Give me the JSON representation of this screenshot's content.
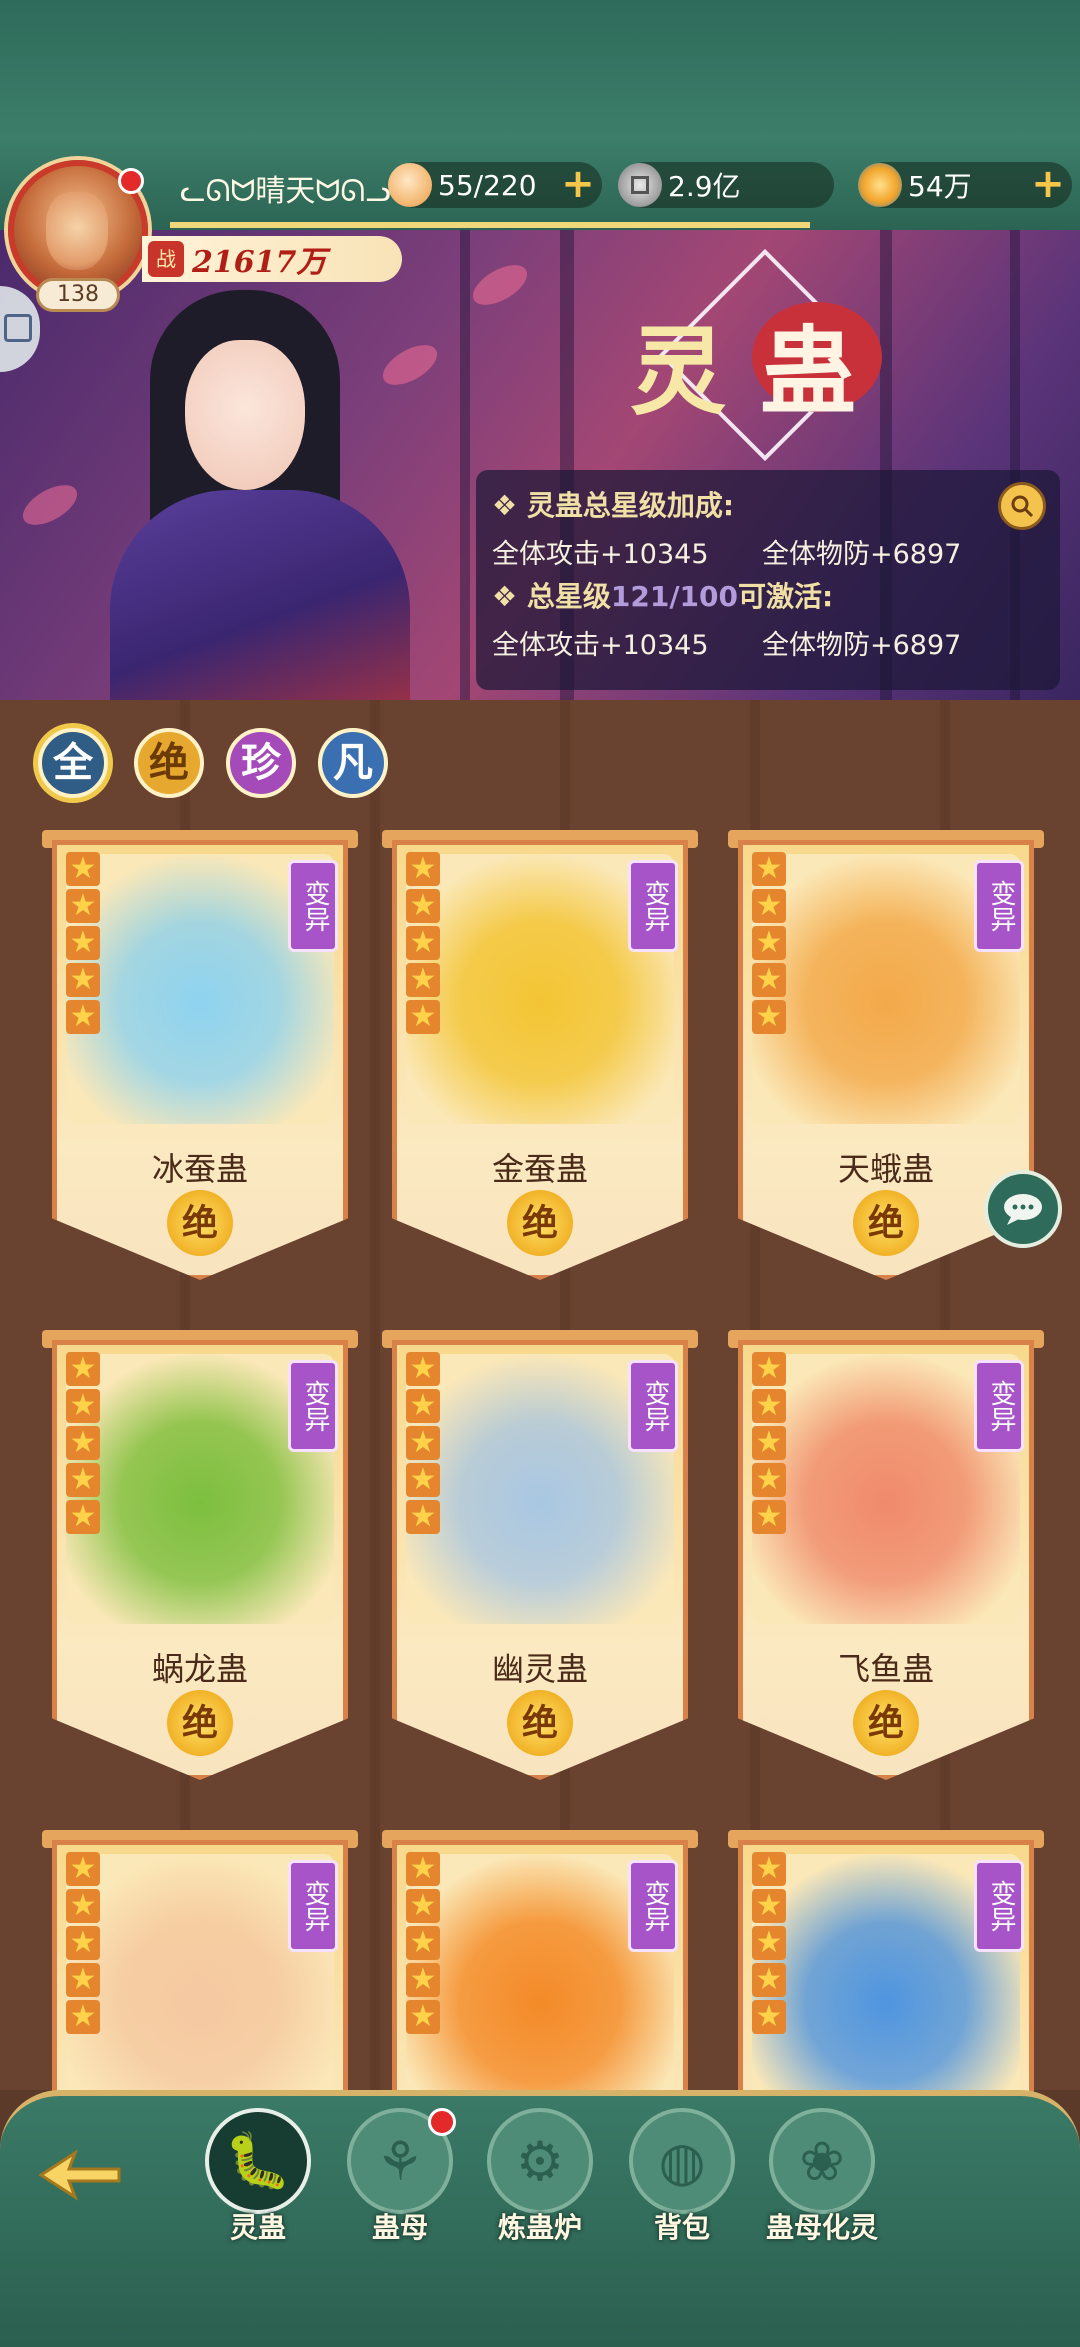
{
  "player": {
    "name": "ᓚᘏᗢ晴天ᗢᘏᓗ",
    "level": "138",
    "power_tag": "战",
    "power": "21617万"
  },
  "resources": {
    "buns": "55/220",
    "coins": "2.9亿",
    "gems": "54万"
  },
  "banner": {
    "title_1": "灵",
    "title_2": "蛊",
    "total_bonus_label": "灵蛊总星级加成:",
    "total_attack": "全体攻击+10345",
    "total_defense": "全体物防+6897",
    "activate_prefix": "总星级",
    "activate_progress": "121/100",
    "activate_suffix": "可激活:",
    "next_attack": "全体攻击+10345",
    "next_defense": "全体物防+6897"
  },
  "filters": [
    "全",
    "绝",
    "珍",
    "凡"
  ],
  "mutation_label": "变异",
  "cards": [
    {
      "name": "冰蚕蛊",
      "rank": "绝",
      "stars": 5,
      "color": "#8ed3f0"
    },
    {
      "name": "金蚕蛊",
      "rank": "绝",
      "stars": 5,
      "color": "#f3c534"
    },
    {
      "name": "天蛾蛊",
      "rank": "绝",
      "stars": 5,
      "color": "#f3a94a"
    },
    {
      "name": "蜗龙蛊",
      "rank": "绝",
      "stars": 5,
      "color": "#7cbf3e"
    },
    {
      "name": "幽灵蛊",
      "rank": "绝",
      "stars": 5,
      "color": "#a9c7e3"
    },
    {
      "name": "飞鱼蛊",
      "rank": "绝",
      "stars": 5,
      "color": "#f08a6c"
    },
    {
      "name": "",
      "rank": "",
      "stars": 5,
      "color": "#f5c9a2"
    },
    {
      "name": "",
      "rank": "",
      "stars": 5,
      "color": "#f48a28"
    },
    {
      "name": "",
      "rank": "",
      "stars": 5,
      "color": "#4f95e0"
    }
  ],
  "nav": [
    {
      "label": "灵蛊",
      "icon": "silkworm-icon",
      "active": true
    },
    {
      "label": "蛊母",
      "icon": "gu-mother-icon",
      "active": false,
      "badge": true
    },
    {
      "label": "炼蛊炉",
      "icon": "furnace-icon",
      "active": false
    },
    {
      "label": "背包",
      "icon": "backpack-icon",
      "active": false
    },
    {
      "label": "蛊母化灵",
      "icon": "spirit-icon",
      "active": false
    }
  ]
}
